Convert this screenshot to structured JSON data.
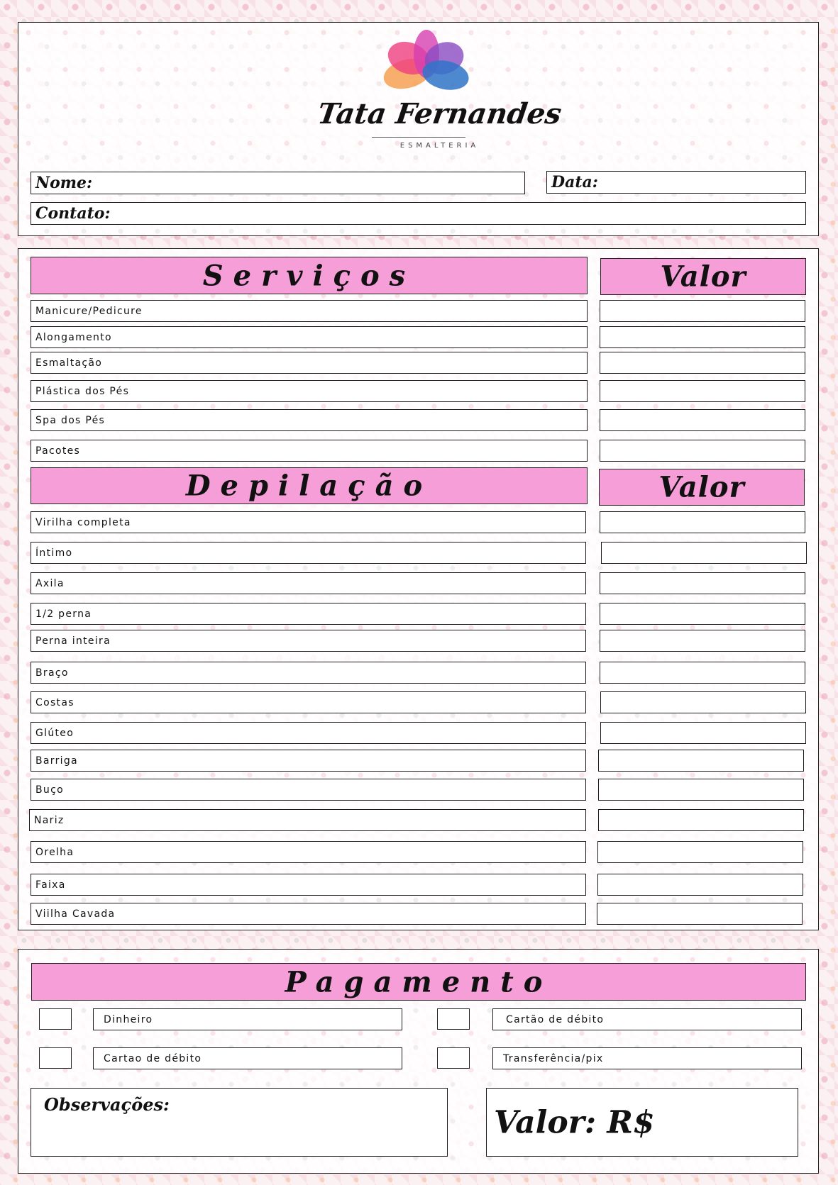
{
  "brand": {
    "name": "Tata Fernandes",
    "tagline": "ESMALTERIA"
  },
  "header": {
    "nome_label": "Nome:",
    "data_label": "Data:",
    "contato_label": "Contato:"
  },
  "servicos": {
    "title": "Serviços",
    "valor_title": "Valor",
    "items": [
      "Manicure/Pedicure",
      "Alongamento",
      "Esmaltação",
      "Plástica dos Pés",
      "Spa dos Pés",
      "Pacotes"
    ]
  },
  "depilacao": {
    "title": "Depilação",
    "valor_title": "Valor",
    "items": [
      "Virilha completa",
      "Íntimo",
      "Axila",
      "1/2 perna",
      "Perna inteira",
      "Braço",
      "Costas",
      "Glúteo",
      "Barriga",
      "Buço",
      "Nariz",
      "Orelha",
      "Faixa",
      "Viilha Cavada"
    ]
  },
  "pagamento": {
    "title": "Pagamento",
    "options": [
      "Dinheiro",
      "Cartão de débito",
      "Cartao de débito",
      "Transferência/pix"
    ]
  },
  "observacoes_label": "Observações:",
  "valor_total_label": "Valor: R$",
  "colors": {
    "pink_header": "#f59ed8",
    "border": "#1a1a1a"
  }
}
